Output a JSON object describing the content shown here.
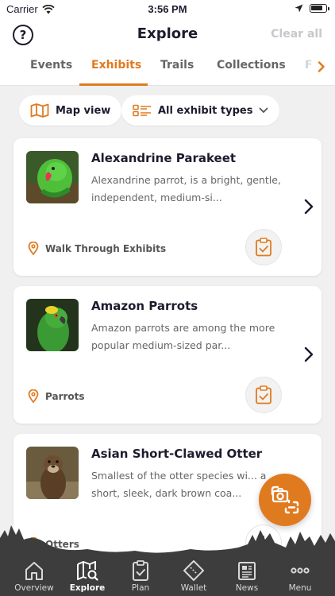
{
  "status_bar": {
    "carrier": "Carrier",
    "time": "3:56 PM"
  },
  "header": {
    "title": "Explore",
    "clear_all": "Clear all"
  },
  "tabs": [
    {
      "label": "Events",
      "active": false
    },
    {
      "label": "Exhibits",
      "active": true
    },
    {
      "label": "Trails",
      "active": false
    },
    {
      "label": "Collections",
      "active": false
    },
    {
      "label": "F",
      "active": false
    }
  ],
  "filters": {
    "map_view": "Map view",
    "exhibit_types": "All exhibit types"
  },
  "exhibits": [
    {
      "title": "Alexandrine Parakeet",
      "description": "Alexandrine parrot, is a bright, gentle, independent, medium-si...",
      "location": "Walk Through Exhibits"
    },
    {
      "title": "Amazon Parrots",
      "description": "Amazon parrots are among the more popular medium-sized par...",
      "location": "Parrots"
    },
    {
      "title": "Asian Short-Clawed Otter",
      "description": "Smallest of the otter species wi... a short, sleek, dark brown coa...",
      "location": "Otters"
    }
  ],
  "tabbar": [
    {
      "label": "Overview",
      "icon": "home-icon",
      "active": false
    },
    {
      "label": "Explore",
      "icon": "map-search-icon",
      "active": true
    },
    {
      "label": "Plan",
      "icon": "clipboard-check-icon",
      "active": false
    },
    {
      "label": "Wallet",
      "icon": "ticket-icon",
      "active": false
    },
    {
      "label": "News",
      "icon": "newspaper-icon",
      "active": false
    },
    {
      "label": "Menu",
      "icon": "more-icon",
      "active": false
    }
  ],
  "colors": {
    "accent": "#e07a1f",
    "text": "#1c1c2e",
    "tabbar": "#3d3d3d"
  }
}
